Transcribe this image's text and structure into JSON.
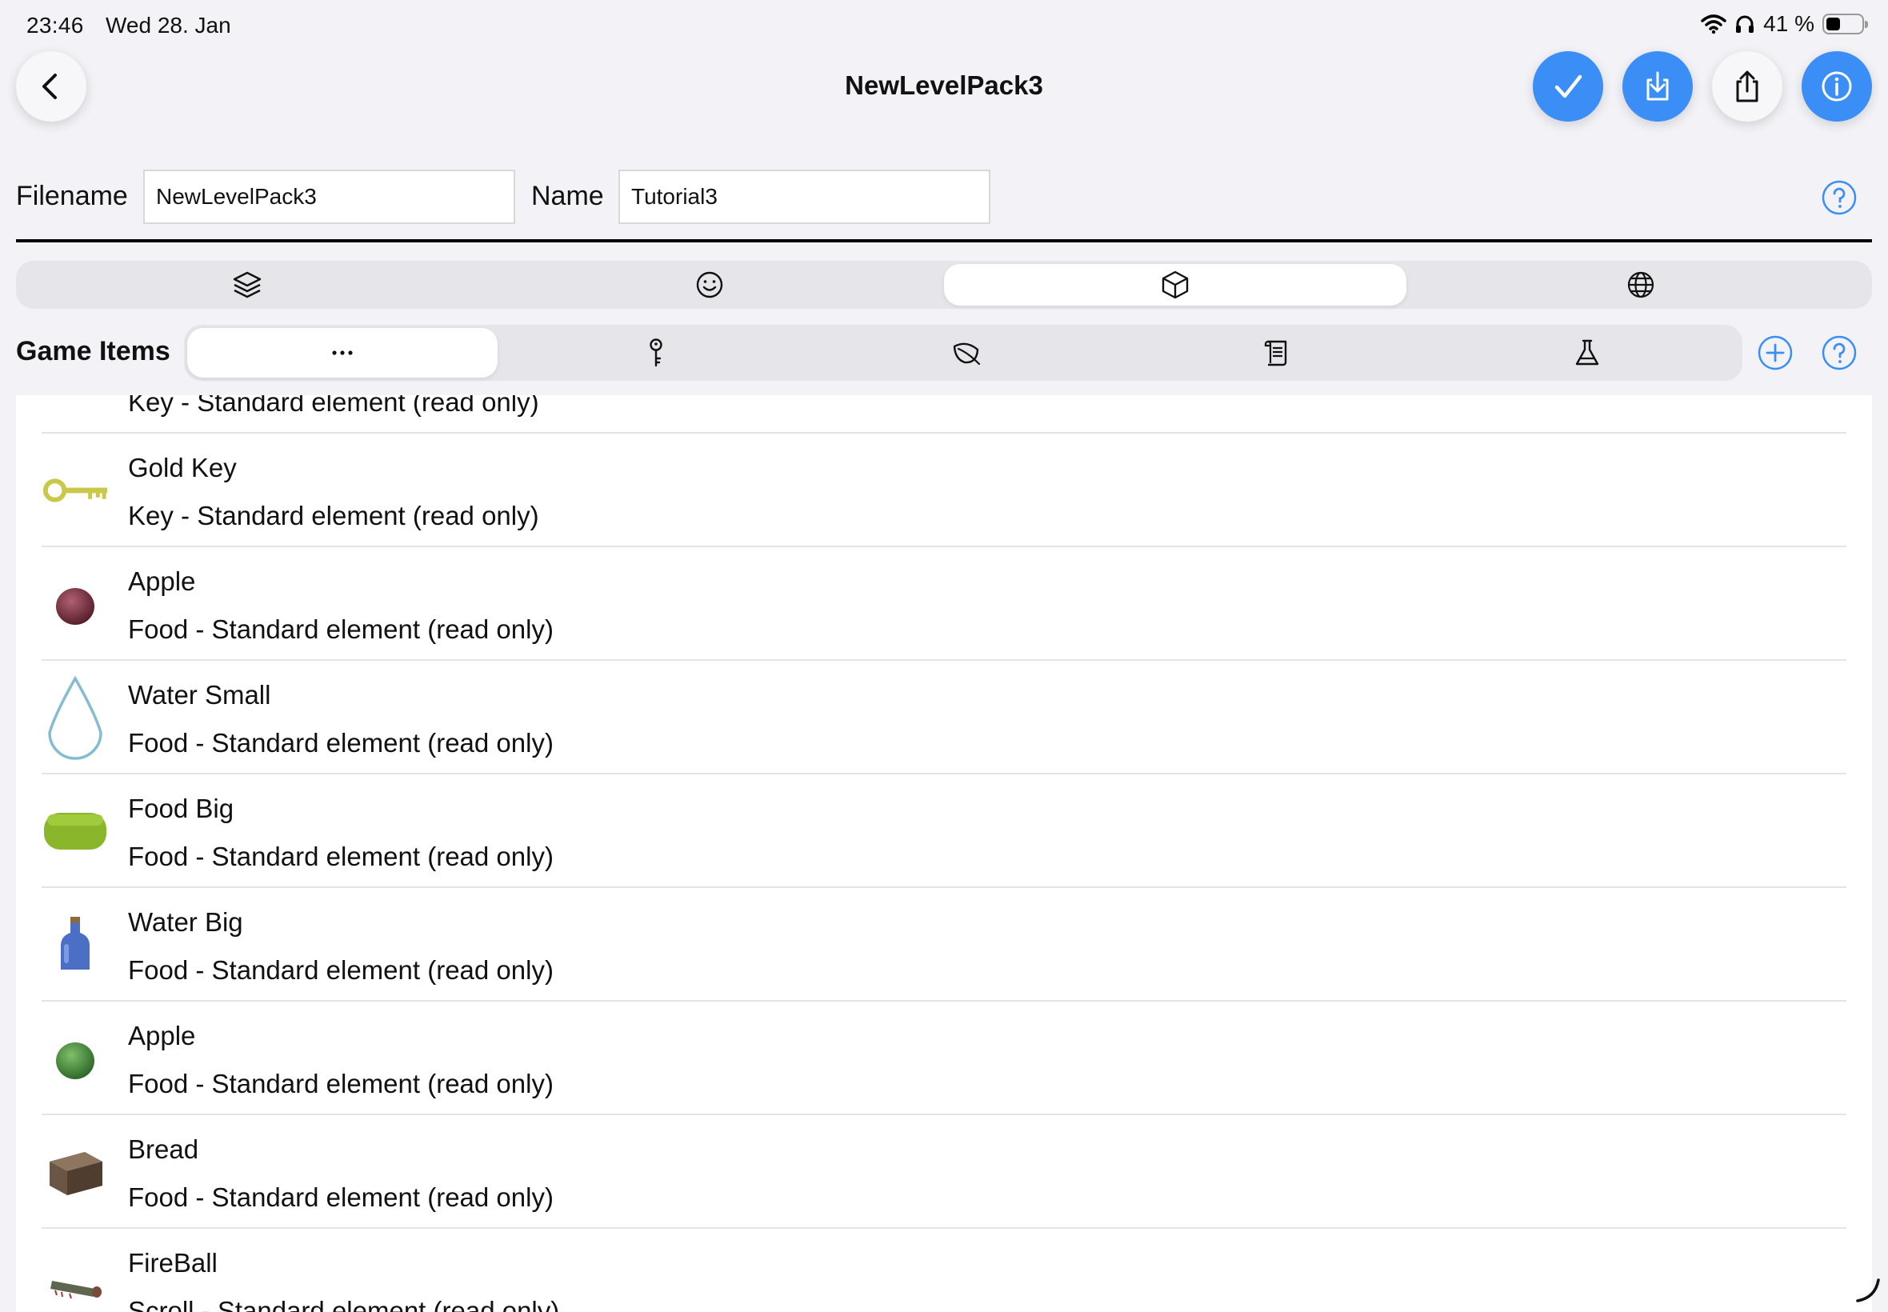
{
  "status": {
    "time": "23:46",
    "date": "Wed 28. Jan",
    "battery_percent": "41 %",
    "battery_level": 0.41
  },
  "header": {
    "title": "NewLevelPack3",
    "icons": [
      "chevron-left-icon",
      "checkmark-icon",
      "download-icon",
      "share-icon",
      "info-icon"
    ]
  },
  "form": {
    "filename_label": "Filename",
    "filename_value": "NewLevelPack3",
    "name_label": "Name",
    "name_value": "Tutorial3"
  },
  "main_tabs": [
    {
      "icon": "layers-icon",
      "selected": false
    },
    {
      "icon": "smiley-icon",
      "selected": false
    },
    {
      "icon": "cube-icon",
      "selected": true
    },
    {
      "icon": "globe-icon",
      "selected": false
    }
  ],
  "section": {
    "title": "Game Items",
    "filters": [
      {
        "icon": "ellipsis-icon",
        "selected": true
      },
      {
        "icon": "key-icon",
        "selected": false
      },
      {
        "icon": "leaf-icon",
        "selected": false
      },
      {
        "icon": "scroll-icon",
        "selected": false
      },
      {
        "icon": "flask-icon",
        "selected": false
      }
    ]
  },
  "items": [
    {
      "name": "",
      "subtitle": "Key - Standard element (read only)",
      "thumb": "key-thumb"
    },
    {
      "name": "Gold Key",
      "subtitle": "Key - Standard element (read only)",
      "thumb": "gold-key-thumb"
    },
    {
      "name": "Apple",
      "subtitle": "Food - Standard element (read only)",
      "thumb": "red-apple-thumb"
    },
    {
      "name": "Water Small",
      "subtitle": "Food - Standard element (read only)",
      "thumb": "water-drop-thumb"
    },
    {
      "name": "Food Big",
      "subtitle": "Food - Standard element (read only)",
      "thumb": "green-food-thumb"
    },
    {
      "name": "Water Big",
      "subtitle": "Food - Standard element (read only)",
      "thumb": "water-bottle-thumb"
    },
    {
      "name": "Apple",
      "subtitle": "Food - Standard element (read only)",
      "thumb": "green-apple-thumb"
    },
    {
      "name": "Bread",
      "subtitle": "Food - Standard element (read only)",
      "thumb": "bread-thumb"
    },
    {
      "name": "FireBall",
      "subtitle": "Scroll - Standard element (read only)",
      "thumb": "scroll-thumb"
    }
  ],
  "colors": {
    "accent": "#3a8ef6",
    "background": "#f2f2f7",
    "segment_bg": "#e5e5ea"
  }
}
